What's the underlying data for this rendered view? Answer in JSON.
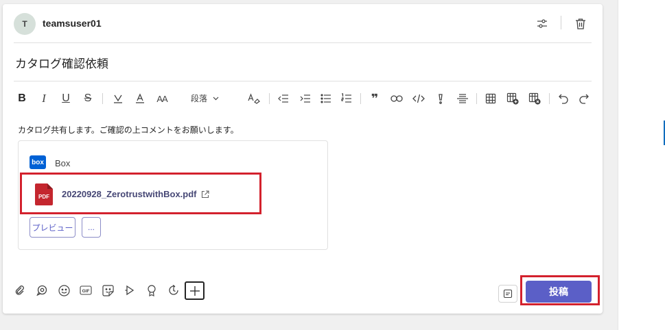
{
  "header": {
    "avatar_initial": "T",
    "username": "teamsuser01"
  },
  "subject": "カタログ確認依頼",
  "toolbar": {
    "paragraph_style": "段落"
  },
  "message_body": "カタログ共有します。ご確認の上コメントをお願いします。",
  "attachment": {
    "provider_logo_text": "box",
    "provider_name": "Box",
    "file_icon_text": "PDF",
    "file_name": "20220928_ZerotrustwithBox.pdf",
    "preview_label": "プレビュー",
    "more_label": "..."
  },
  "actions": {
    "post_label": "投稿"
  },
  "colors": {
    "accent": "#5b5fc7",
    "highlight": "#d3212d",
    "box_brand": "#0061d5",
    "pdf_red": "#c4262e"
  }
}
